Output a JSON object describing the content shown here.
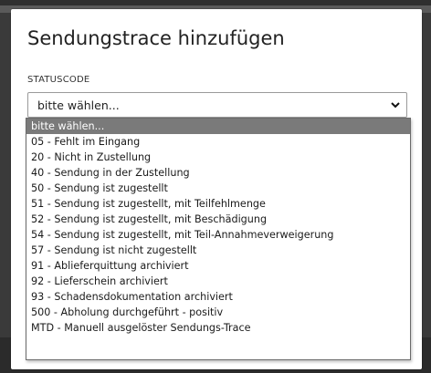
{
  "modal": {
    "title": "Sendungstrace hinzufügen",
    "field_label": "STATUSCODE",
    "select_value": "bitte wählen..."
  },
  "dropdown": {
    "selected_index": 0,
    "options": [
      "bitte wählen...",
      "05 - Fehlt im Eingang",
      "20 - Nicht in Zustellung",
      "40 - Sendung in der Zustellung",
      "50 - Sendung ist zugestellt",
      "51 - Sendung ist zugestellt, mit Teilfehlmenge",
      "52 - Sendung ist zugestellt, mit Beschädigung",
      "54 - Sendung ist zugestellt, mit Teil-Annahmeverweigerung",
      "57 - Sendung ist nicht zugestellt",
      "91 - Ablieferquittung archiviert",
      "92 - Lieferschein archiviert",
      "93 - Schadensdokumentation archiviert",
      "500 - Abholung durchgeführt - positiv",
      "MTD - Manuell ausgelöster Sendungs-Trace"
    ]
  },
  "icons": {
    "select_chevron": "chevron-down-icon"
  },
  "colors": {
    "selected_option_bg": "#7a7a7a",
    "overlay_bg": "#3a3a3a"
  }
}
